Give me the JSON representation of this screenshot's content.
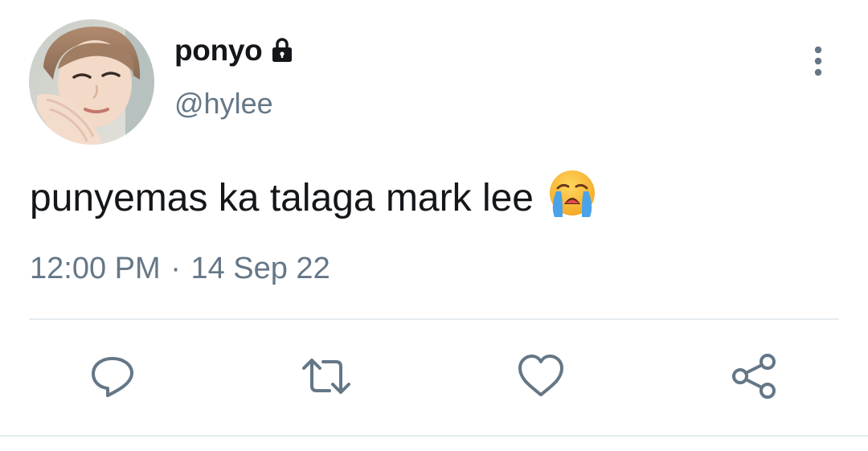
{
  "user": {
    "display_name": "ponyo",
    "handle": "@hylee",
    "protected_icon": "lock-icon",
    "avatar_icon": "profile-photo"
  },
  "tweet": {
    "text": "punyemas ka talaga mark lee",
    "emoji": "loudly-crying-face-emoji"
  },
  "meta": {
    "time": "12:00 PM",
    "separator": "·",
    "date": "14 Sep 22"
  },
  "actions": [
    {
      "name": "reply",
      "icon": "reply-icon"
    },
    {
      "name": "retweet",
      "icon": "retweet-icon"
    },
    {
      "name": "like",
      "icon": "heart-icon"
    },
    {
      "name": "share",
      "icon": "share-icon"
    }
  ],
  "colors": {
    "text_primary": "#14171a",
    "text_secondary": "#657786",
    "icon": "#657786",
    "divider": "#e6ecf0"
  }
}
